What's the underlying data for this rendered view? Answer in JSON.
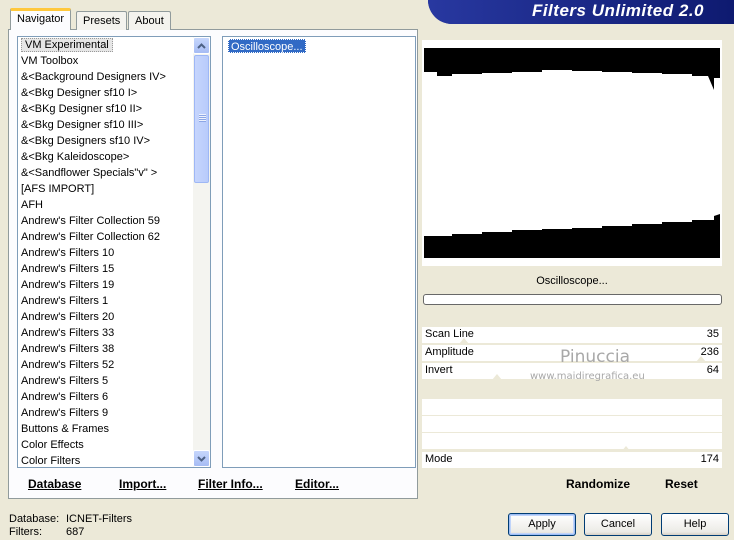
{
  "app": {
    "title": "Filters Unlimited 2.0"
  },
  "tabs": [
    {
      "label": "Navigator",
      "active": true
    },
    {
      "label": "Presets",
      "active": false
    },
    {
      "label": "About",
      "active": false
    }
  ],
  "categories": [
    "VM Experimental",
    "VM Toolbox",
    "&<Background Designers IV>",
    "&<Bkg Designer sf10 I>",
    "&<BKg Designer sf10 II>",
    "&<Bkg Designer sf10 III>",
    "&<Bkg Designers sf10 IV>",
    "&<Bkg Kaleidoscope>",
    "&<Sandflower Specials\"v\" >",
    "[AFS IMPORT]",
    "AFH",
    "Andrew's Filter Collection 59",
    "Andrew's Filter Collection 62",
    "Andrew's Filters 10",
    "Andrew's Filters 15",
    "Andrew's Filters 19",
    "Andrew's Filters 1",
    "Andrew's Filters 20",
    "Andrew's Filters 33",
    "Andrew's Filters 38",
    "Andrew's Filters 52",
    "Andrew's Filters 5",
    "Andrew's Filters 6",
    "Andrew's Filters 9",
    "Buttons & Frames",
    "Color Effects",
    "Color Filters"
  ],
  "selected_category": "VM Experimental",
  "filters": [
    "Oscilloscope..."
  ],
  "selected_filter": "Oscilloscope...",
  "left_buttons": {
    "database": "Database",
    "import": "Import...",
    "filter_info": "Filter Info...",
    "editor": "Editor..."
  },
  "preview": {
    "filter_name": "Oscilloscope..."
  },
  "params": [
    {
      "label": "Scan Line",
      "value": "35",
      "fraction": 0.14
    },
    {
      "label": "Amplitude",
      "value": "236",
      "fraction": 0.93
    },
    {
      "label": "Invert",
      "value": "64",
      "fraction": 0.25
    }
  ],
  "mode_param": {
    "label": "Mode",
    "value": "174",
    "fraction": 0.68
  },
  "watermark": {
    "name": "Pinuccia",
    "url": "www.maidiregrafica.eu"
  },
  "actions": {
    "randomize": "Randomize",
    "reset": "Reset"
  },
  "status": {
    "database_label": "Database:",
    "database_value": "ICNET-Filters",
    "filters_label": "Filters:",
    "filters_value": "687"
  },
  "dialog_buttons": {
    "apply": "Apply",
    "cancel": "Cancel",
    "help": "Help"
  },
  "colors": {
    "banner": "#1a2a8c",
    "selection": "#316ac5",
    "tab_highlight": "#ffc83c"
  }
}
